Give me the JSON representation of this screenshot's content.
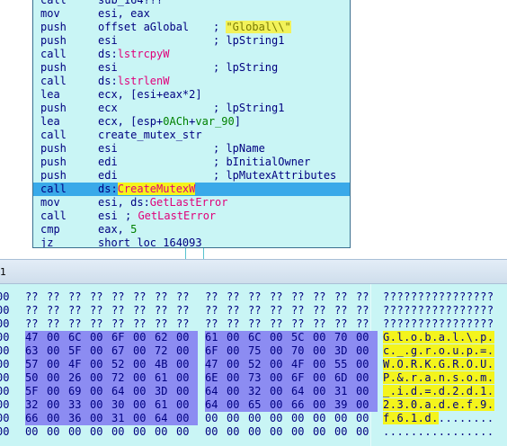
{
  "disassembly": [
    {
      "mn": "call",
      "op": "sub_164???",
      "cm": ""
    },
    {
      "mn": "mov",
      "op": "esi, eax",
      "cm": ""
    },
    {
      "mn": "push",
      "op": "offset aGlobal",
      "cm": "; ",
      "cm_str": "\"Global\\\\\""
    },
    {
      "mn": "push",
      "op": "esi",
      "cm": "; lpString1"
    },
    {
      "mn": "call",
      "op_prefix": "ds:",
      "op_imp": "lstrcpyW"
    },
    {
      "mn": "push",
      "op": "esi",
      "cm": "; lpString"
    },
    {
      "mn": "call",
      "op_prefix": "ds:",
      "op_imp": "lstrlenW"
    },
    {
      "mn": "lea",
      "op": "ecx, [esi+eax*2]",
      "cm": ""
    },
    {
      "mn": "push",
      "op": "ecx",
      "cm": "; lpString1"
    },
    {
      "mn": "lea",
      "op_a": "ecx, [esp+",
      "op_num": "0ACh",
      "op_b": "+",
      "op_var": "var_90",
      "op_c": "]"
    },
    {
      "mn": "call",
      "op": "create_mutex_str",
      "cm": ""
    },
    {
      "mn": "push",
      "op": "esi",
      "cm": "; lpName"
    },
    {
      "mn": "push",
      "op": "edi",
      "cm": "; bInitialOwner"
    },
    {
      "mn": "push",
      "op": "edi",
      "cm": "; lpMutexAttributes"
    },
    {
      "mn": "call",
      "op_prefix": "ds:",
      "op_imp": "CreateMutexW",
      "highlight": true
    },
    {
      "mn": "mov",
      "op_prefix": "esi, ds:",
      "op_imp": "GetLastError"
    },
    {
      "mn": "call",
      "op": "esi",
      "cm": "; ",
      "cm_imp": "GetLastError"
    },
    {
      "mn": "cmp",
      "op_a": "eax, ",
      "op_num": "5"
    },
    {
      "mn": "jz",
      "op": "short loc_164093",
      "cm": ""
    }
  ],
  "divider": {
    "label": "1"
  },
  "hex": [
    {
      "addr": "00",
      "bytes": [
        "??",
        "??",
        "??",
        "??",
        "??",
        "??",
        "??",
        "??",
        "??",
        "??",
        "??",
        "??",
        "??",
        "??",
        "??",
        "??"
      ],
      "ascii": "????????????????",
      "sel_from": -1,
      "sel_to": -1
    },
    {
      "addr": "00",
      "bytes": [
        "??",
        "??",
        "??",
        "??",
        "??",
        "??",
        "??",
        "??",
        "??",
        "??",
        "??",
        "??",
        "??",
        "??",
        "??",
        "??"
      ],
      "ascii": "????????????????",
      "sel_from": -1,
      "sel_to": -1
    },
    {
      "addr": "00",
      "bytes": [
        "??",
        "??",
        "??",
        "??",
        "??",
        "??",
        "??",
        "??",
        "??",
        "??",
        "??",
        "??",
        "??",
        "??",
        "??",
        "??"
      ],
      "ascii": "????????????????",
      "sel_from": -1,
      "sel_to": -1
    },
    {
      "addr": "00",
      "bytes": [
        "47",
        "00",
        "6C",
        "00",
        "6F",
        "00",
        "62",
        "00",
        "61",
        "00",
        "6C",
        "00",
        "5C",
        "00",
        "70",
        "00"
      ],
      "ascii": "G.l.o.b.a.l.\\.p.",
      "sel_from": 0,
      "sel_to": 15
    },
    {
      "addr": "00",
      "bytes": [
        "63",
        "00",
        "5F",
        "00",
        "67",
        "00",
        "72",
        "00",
        "6F",
        "00",
        "75",
        "00",
        "70",
        "00",
        "3D",
        "00"
      ],
      "ascii": "c._.g.r.o.u.p.=.",
      "sel_from": 0,
      "sel_to": 15
    },
    {
      "addr": "00",
      "bytes": [
        "57",
        "00",
        "4F",
        "00",
        "52",
        "00",
        "4B",
        "00",
        "47",
        "00",
        "52",
        "00",
        "4F",
        "00",
        "55",
        "00"
      ],
      "ascii": "W.O.R.K.G.R.O.U.",
      "sel_from": 0,
      "sel_to": 15
    },
    {
      "addr": "00",
      "bytes": [
        "50",
        "00",
        "26",
        "00",
        "72",
        "00",
        "61",
        "00",
        "6E",
        "00",
        "73",
        "00",
        "6F",
        "00",
        "6D",
        "00"
      ],
      "ascii": "P.&.r.a.n.s.o.m.",
      "sel_from": 0,
      "sel_to": 15
    },
    {
      "addr": "00",
      "bytes": [
        "5F",
        "00",
        "69",
        "00",
        "64",
        "00",
        "3D",
        "00",
        "64",
        "00",
        "32",
        "00",
        "64",
        "00",
        "31",
        "00"
      ],
      "ascii": "_.i.d.=.d.2.d.1.",
      "sel_from": 0,
      "sel_to": 15
    },
    {
      "addr": "00",
      "bytes": [
        "32",
        "00",
        "33",
        "00",
        "30",
        "00",
        "61",
        "00",
        "64",
        "00",
        "65",
        "00",
        "66",
        "00",
        "39",
        "00"
      ],
      "ascii": "2.3.0.a.d.e.f.9.",
      "sel_from": 0,
      "sel_to": 15
    },
    {
      "addr": "00",
      "bytes": [
        "66",
        "00",
        "36",
        "00",
        "31",
        "00",
        "64",
        "00",
        "00",
        "00",
        "00",
        "00",
        "00",
        "00",
        "00",
        "00"
      ],
      "ascii": "f.6.1.d.........",
      "sel_from": 0,
      "sel_to": 7
    },
    {
      "addr": "00",
      "bytes": [
        "00",
        "00",
        "00",
        "00",
        "00",
        "00",
        "00",
        "00",
        "00",
        "00",
        "00",
        "00",
        "00",
        "00",
        "00",
        "00"
      ],
      "ascii": "................",
      "sel_from": -1,
      "sel_to": -1
    }
  ]
}
